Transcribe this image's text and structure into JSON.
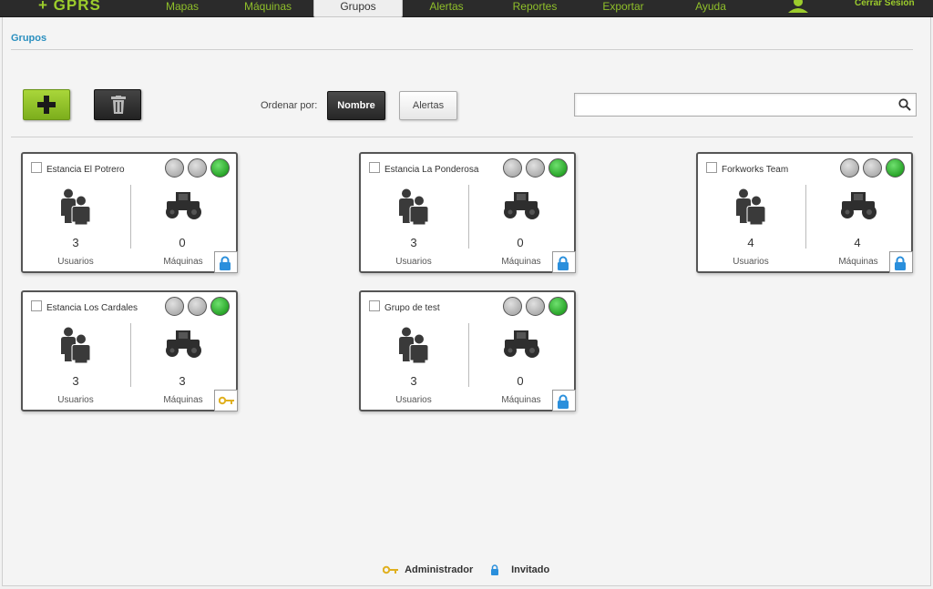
{
  "app": {
    "logo": "+ GPRS",
    "logout": "Cerrar Sesión"
  },
  "nav": [
    {
      "label": "Mapas",
      "active": false
    },
    {
      "label": "Máquinas",
      "active": false
    },
    {
      "label": "Grupos",
      "active": true
    },
    {
      "label": "Alertas",
      "active": false
    },
    {
      "label": "Reportes",
      "active": false
    },
    {
      "label": "Exportar",
      "active": false
    },
    {
      "label": "Ayuda",
      "active": false
    }
  ],
  "breadcrumb": "Grupos",
  "toolbar": {
    "add_icon": "plus-icon",
    "delete_icon": "trash-icon",
    "sort_label": "Ordenar por:",
    "sort_options": [
      "Nombre",
      "Alertas"
    ],
    "sort_selected": "Nombre",
    "search_value": "",
    "search_icon": "search-icon"
  },
  "groups": [
    {
      "name": "Estancia El Potrero",
      "users": "3",
      "users_label": "Usuarios",
      "machines": "0",
      "machines_label": "Máquinas",
      "role": "invitado",
      "lights": [
        "grey",
        "grey",
        "green"
      ]
    },
    {
      "name": "Estancia La Ponderosa",
      "users": "3",
      "users_label": "Usuarios",
      "machines": "0",
      "machines_label": "Máquinas",
      "role": "invitado",
      "lights": [
        "grey",
        "grey",
        "green"
      ]
    },
    {
      "name": "Forkworks Team",
      "users": "4",
      "users_label": "Usuarios",
      "machines": "4",
      "machines_label": "Máquinas",
      "role": "invitado",
      "lights": [
        "grey",
        "grey",
        "green"
      ]
    },
    {
      "name": "Estancia Los Cardales",
      "users": "3",
      "users_label": "Usuarios",
      "machines": "3",
      "machines_label": "Máquinas",
      "role": "administrador",
      "lights": [
        "grey",
        "grey",
        "green"
      ]
    },
    {
      "name": "Grupo de test",
      "users": "3",
      "users_label": "Usuarios",
      "machines": "0",
      "machines_label": "Máquinas",
      "role": "invitado",
      "lights": [
        "grey",
        "grey",
        "green"
      ]
    }
  ],
  "legend": {
    "admin": "Administrador",
    "guest": "Invitado"
  },
  "colors": {
    "accent": "#8fbf2a",
    "light_green": "#1aa31a",
    "light_grey": "#b5b5b5",
    "admin_key": "#e0b020",
    "guest_lock": "#2a8fdc"
  }
}
